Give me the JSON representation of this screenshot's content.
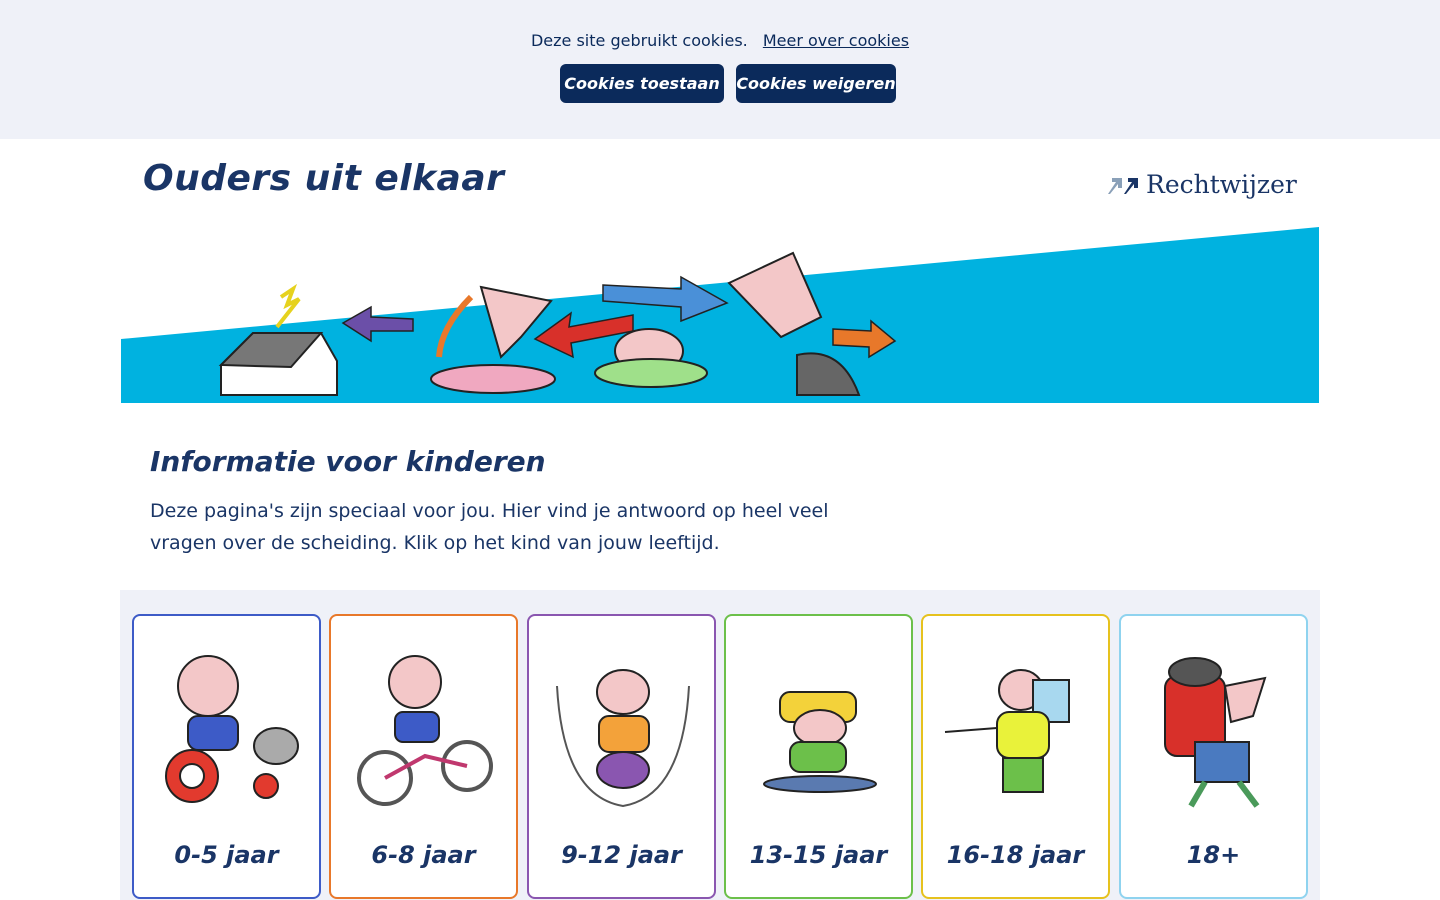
{
  "cookies": {
    "message": "Deze site gebruikt cookies.",
    "more_link": "Meer over cookies",
    "accept_label": "Cookies toestaan",
    "refuse_label": "Cookies weigeren"
  },
  "header": {
    "title": "Ouders uit elkaar",
    "logo_text": "Rechtwijzer"
  },
  "intro": {
    "title": "Informatie voor kinderen",
    "text": "Deze pagina's zijn speciaal voor jou. Hier vind je antwoord op heel veel vragen over de scheiding. Klik op het kind van jouw leeftijd."
  },
  "cards": [
    {
      "label": "0-5 jaar",
      "border": "#3d5bc7",
      "icon": "child-on-tricycle-icon"
    },
    {
      "label": "6-8 jaar",
      "border": "#e8782a",
      "icon": "child-on-bicycle-icon"
    },
    {
      "label": "9-12 jaar",
      "border": "#8a56b0",
      "icon": "girl-jumping-rope-icon"
    },
    {
      "label": "13-15 jaar",
      "border": "#6cc04a",
      "icon": "teen-on-skateboard-icon"
    },
    {
      "label": "16-18 jaar",
      "border": "#e6c21e",
      "icon": "teen-reading-book-icon"
    },
    {
      "label": "18+",
      "border": "#8fd3ef",
      "icon": "backpacker-icon"
    }
  ],
  "colors": {
    "navy": "#0b2a5b",
    "hero_blue": "#00b2e0",
    "banner_bg": "#eff1f8"
  }
}
